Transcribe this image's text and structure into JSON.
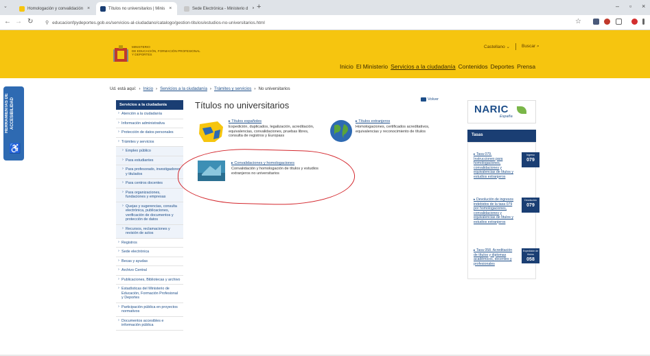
{
  "browser": {
    "tabs": [
      {
        "label": "Homologación y convalidación",
        "favicon_color": "#f6c50f",
        "active": false
      },
      {
        "label": "Títulos no universitarios | Minis",
        "favicon_color": "#1a3e73",
        "active": true
      },
      {
        "label": "Sede Electrónica - Ministerio d",
        "favicon_color": "#c8c8c8",
        "active": false
      }
    ],
    "new_tab": "+",
    "tab_close": "×",
    "tab_dropdown": "⌄",
    "window_controls": {
      "minimize": "–",
      "maximize": "▫",
      "close": "×"
    },
    "nav": {
      "back": "←",
      "forward": "→",
      "reload": "↻"
    },
    "site_info": "⚲",
    "url": "educacionfpydeportes.gob.es/servicios-al-ciudadano/catalogo/gestion-titulos/estudios-no-universitarios.html",
    "bookmark_icon": "☆"
  },
  "header": {
    "ministry_lines": [
      "MINISTERIO",
      "DE EDUCACIÓN, FORMACIÓN PROFESIONAL",
      "Y DEPORTES"
    ],
    "language": "Castellano",
    "language_chevron": "⌄",
    "search_label": "Buscar",
    "search_icon_glyph": "⌕",
    "nav": [
      "Inicio",
      "El Ministerio",
      "Servicios a la ciudadanía",
      "Contenidos",
      "Deportes",
      "Prensa"
    ]
  },
  "accessibility": {
    "label": "HERRAMIENTAS DE ACCESIBILIDAD",
    "icon_glyph": "♿"
  },
  "breadcrumb": {
    "prefix": "Ud. está aquí:",
    "items": [
      "Inicio",
      "Servicios a la ciudadanía",
      "Trámites y servicios",
      "No universitarios"
    ],
    "separator": "›"
  },
  "sidebar": {
    "heading": "Servicios a la ciudadanía",
    "items": [
      {
        "label": "Atención a la ciudadanía",
        "sub": false
      },
      {
        "label": "Información administrativa",
        "sub": false
      },
      {
        "label": "Protección de datos personales",
        "sub": false
      },
      {
        "label": "Trámites y servicios",
        "sub": false
      },
      {
        "label": "Empleo público",
        "sub": true
      },
      {
        "label": "Para estudiantes",
        "sub": true
      },
      {
        "label": "Para profesorado, investigadores y titulados",
        "sub": true
      },
      {
        "label": "Para centros docentes",
        "sub": true
      },
      {
        "label": "Para organizaciones, fundaciones y empresas",
        "sub": true
      },
      {
        "label": "Quejas y sugerencias, consulta electrónica, publicaciones, verificación de documentos y protección de datos",
        "sub": true
      },
      {
        "label": "Recursos, reclamaciones y revisión de actos",
        "sub": true
      },
      {
        "label": "Registros",
        "sub": false
      },
      {
        "label": "Sede electrónica",
        "sub": false
      },
      {
        "label": "Becas y ayudas",
        "sub": false
      },
      {
        "label": "Archivo Central",
        "sub": false
      },
      {
        "label": "Publicaciones, Bibliotecas y archivo",
        "sub": false
      },
      {
        "label": "Estadísticas del Ministerio de Educación, Formación Profesional y Deportes",
        "sub": false
      },
      {
        "label": "Participación pública en proyectos normativos",
        "sub": false
      },
      {
        "label": "Documentos accesibles e información pública",
        "sub": false
      }
    ]
  },
  "main": {
    "title": "Títulos no universitarios",
    "view_label": "Volver",
    "cards": [
      {
        "title": "Títulos españoles",
        "desc": "Expedición, duplicados, legalización, acreditación, equivalencias, convalidaciones, pruebas libres, consulta de registros y Europass"
      },
      {
        "title": "Títulos extranjeros",
        "desc": "Homologaciones, certificados acreditativos, equivalencias y reconocimiento de títulos"
      },
      {
        "title": "Convalidaciones y homologaciones",
        "desc": "Convalidación y homologación de títulos y estudios extranjeros no universitarios"
      }
    ]
  },
  "right": {
    "naric_logo": "NARIC",
    "naric_sub": "España",
    "tasas_heading": "Tasas",
    "tasas": [
      {
        "text": "Tasa 079. Instrucciones para homologaciones, convalidaciones y equivalencias de títulos y estudios extranjeros",
        "badge_small": "Ingreso",
        "badge_code": "079"
      },
      {
        "text": "Devolución de ingresos indebidos de la tasa 079 por homologaciones, convalidaciones y equivalencias de títulos y estudios extranjeros",
        "badge_small": "Devolución",
        "badge_code": "079"
      },
      {
        "text": "Tasa 058. Acreditación de títulos y diplomas académicos, docentes y profesionales",
        "badge_small": "Expedición de títulos",
        "badge_code": "058"
      }
    ]
  },
  "colors": {
    "header_yellow": "#f6c50f",
    "navy": "#1a3e73",
    "link": "#1d4e89",
    "annotation_red": "#d3242a"
  }
}
